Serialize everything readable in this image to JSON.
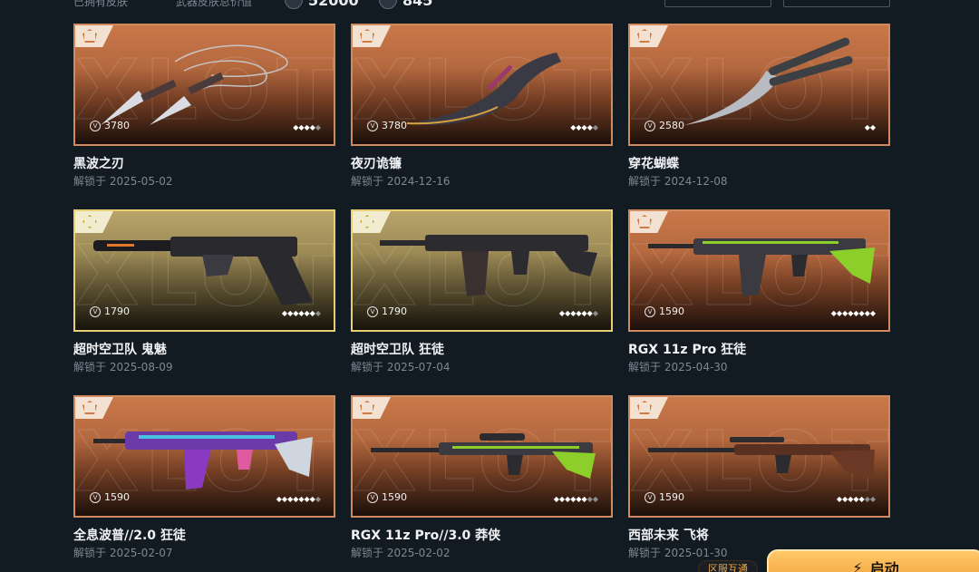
{
  "topbar": {
    "owned_label": "已拥有皮肤",
    "value_label": "武器皮肤总价值",
    "stat_a": "52000",
    "stat_b": "845"
  },
  "items": [
    {
      "name": "黑波之刃",
      "date": "解锁于 2025-05-02",
      "price": "3780",
      "filled": 4,
      "total": 5,
      "tier": "deluxe",
      "weapon": "kunai"
    },
    {
      "name": "夜刃诡镰",
      "date": "解锁于 2024-12-16",
      "price": "3780",
      "filled": 4,
      "total": 5,
      "tier": "deluxe",
      "weapon": "sickle"
    },
    {
      "name": "穿花蝴蝶",
      "date": "解锁于 2024-12-08",
      "price": "2580",
      "filled": 2,
      "total": 2,
      "tier": "deluxe",
      "weapon": "butterfly"
    },
    {
      "name": "超时空卫队 鬼魅",
      "date": "解锁于 2025-08-09",
      "price": "1790",
      "filled": 6,
      "total": 7,
      "tier": "select",
      "weapon": "pistol"
    },
    {
      "name": "超时空卫队 狂徒",
      "date": "解锁于 2025-07-04",
      "price": "1790",
      "filled": 6,
      "total": 7,
      "tier": "select",
      "weapon": "rifle-dark"
    },
    {
      "name": "RGX 11z Pro 狂徒",
      "date": "解锁于 2025-04-30",
      "price": "1590",
      "filled": 8,
      "total": 8,
      "tier": "deluxe",
      "weapon": "rifle-green"
    },
    {
      "name": "全息波普//2.0 狂徒",
      "date": "解锁于 2025-02-07",
      "price": "1590",
      "filled": 7,
      "total": 8,
      "tier": "deluxe",
      "weapon": "rifle-holo"
    },
    {
      "name": "RGX 11z Pro//3.0 莽侠",
      "date": "解锁于 2025-02-02",
      "price": "1590",
      "filled": 6,
      "total": 8,
      "tier": "deluxe",
      "weapon": "sniper-green"
    },
    {
      "name": "西部未来 飞将",
      "date": "解锁于 2025-01-30",
      "price": "1590",
      "filled": 5,
      "total": 7,
      "tier": "deluxe",
      "weapon": "rifle-wood"
    }
  ],
  "bottom": {
    "tag": "区服互通",
    "launch_label": "启动"
  },
  "watermark": "XLOT",
  "colors": {
    "deluxe_border": "#d08a5e",
    "select_border": "#e8cf74",
    "background": "#121a22",
    "launch": "#f2a43a"
  }
}
